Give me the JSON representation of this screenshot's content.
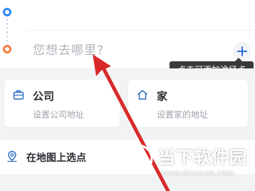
{
  "route": {
    "start_dot": "start-point",
    "end_dot": "end-point",
    "destination_placeholder": "您想去哪里?",
    "add_waypoint_icon": "plus-icon",
    "tooltip": "点击可添加途经点"
  },
  "shortcuts": {
    "company": {
      "icon": "briefcase-icon",
      "title": "公司",
      "subtitle": "设置公司地址"
    },
    "home": {
      "icon": "house-icon",
      "title": "家",
      "subtitle": "设置家的地址"
    }
  },
  "map_pick": {
    "icon": "map-pin-icon",
    "label": "在地图上选点"
  },
  "watermark": {
    "title": "当下软件园",
    "url": "www.downxia.com"
  },
  "colors": {
    "start": "#2f8bf6",
    "end": "#f47b3a",
    "arrow": "#d82a2a",
    "background": "#f2f3f5"
  }
}
